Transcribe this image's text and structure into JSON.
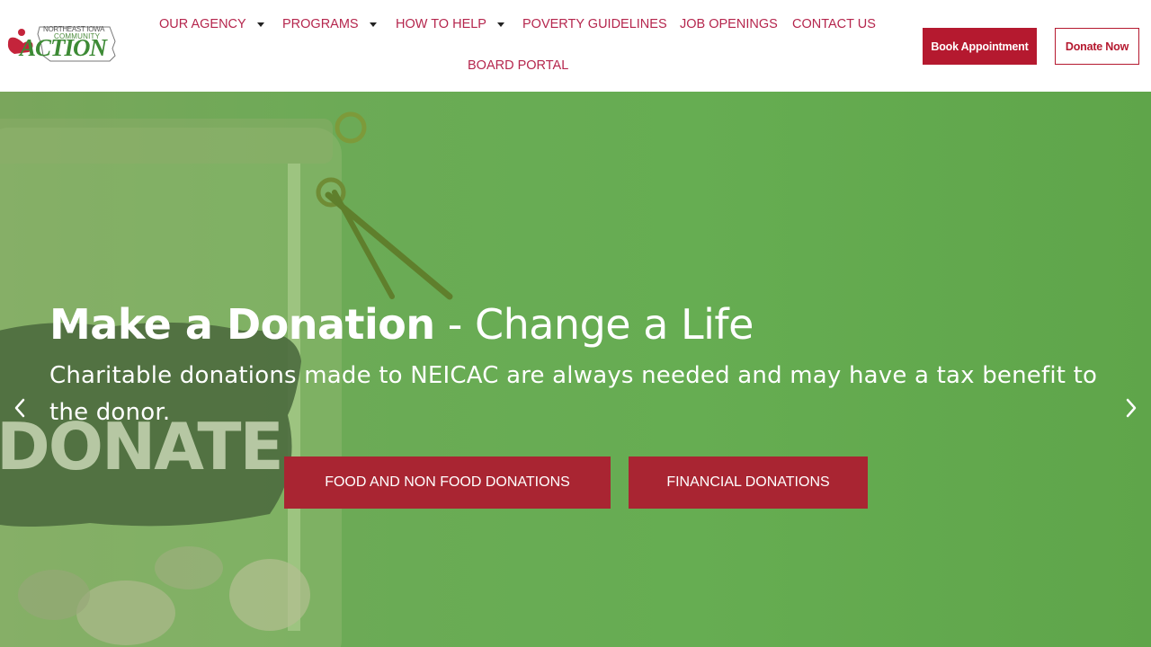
{
  "header": {
    "logo": {
      "line1": "NORTHEAST IOWA",
      "line2": "COMMUNITY",
      "main": "ACTION"
    },
    "nav": [
      {
        "label": "OUR AGENCY",
        "has_dropdown": true
      },
      {
        "label": "PROGRAMS",
        "has_dropdown": true
      },
      {
        "label": "HOW TO HELP",
        "has_dropdown": true
      },
      {
        "label": "POVERTY GUIDELINES",
        "has_dropdown": false
      },
      {
        "label": "JOB OPENINGS",
        "has_dropdown": false
      },
      {
        "label": "CONTACT US",
        "has_dropdown": false
      },
      {
        "label": "BOARD PORTAL",
        "has_dropdown": false
      }
    ],
    "book_button": "Book Appointment",
    "donate_button": "Donate Now"
  },
  "hero": {
    "title_strong": "Make a Donation",
    "title_light": " - Change a Life",
    "subtitle": "Charitable donations made to NEICAC are always needed and may have a tax benefit to the donor.",
    "button_food": "FOOD AND NON FOOD DONATIONS",
    "button_financial": "FINANCIAL DONATIONS",
    "jar_label": "DONATE",
    "prev_icon": "chevron-left-icon",
    "next_icon": "chevron-right-icon"
  },
  "colors": {
    "brand_red": "#b5192f",
    "nav_text": "#b5264d",
    "hero_green": "#66ad52",
    "button_red": "#a92532"
  }
}
